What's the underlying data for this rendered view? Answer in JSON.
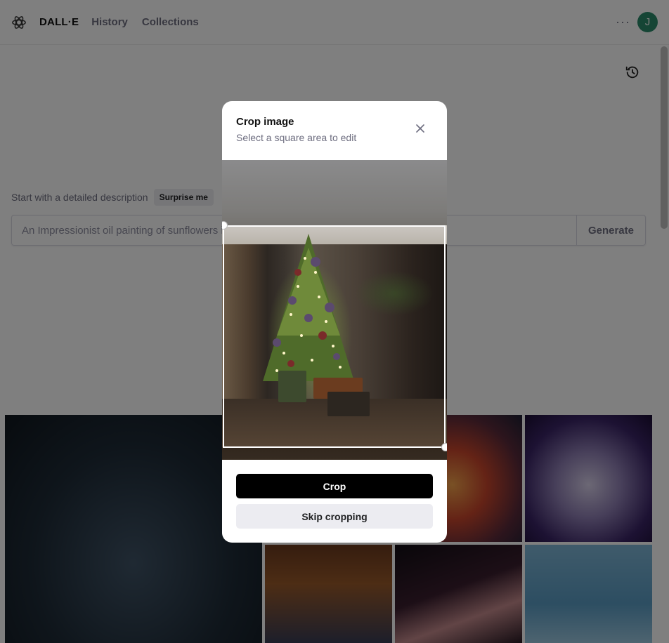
{
  "header": {
    "brand": "DALL·E",
    "nav": [
      "History",
      "Collections"
    ],
    "more_label": "···",
    "avatar_initial": "J"
  },
  "prompt": {
    "label": "Start with a detailed description",
    "surprise_label": "Surprise me",
    "placeholder": "An Impressionist oil painting of sunflowers in a purple vase…",
    "generate_label": "Generate"
  },
  "modal": {
    "title": "Crop image",
    "subtitle": "Select a square area to edit",
    "crop_label": "Crop",
    "skip_label": "Skip cropping"
  },
  "colors": {
    "overlay": "#000000",
    "primary_button": "#000000",
    "secondary_button": "#ececf1",
    "avatar": "#2a8a6b"
  },
  "icons": [
    "openai-logo-icon",
    "history-icon",
    "close-icon"
  ]
}
